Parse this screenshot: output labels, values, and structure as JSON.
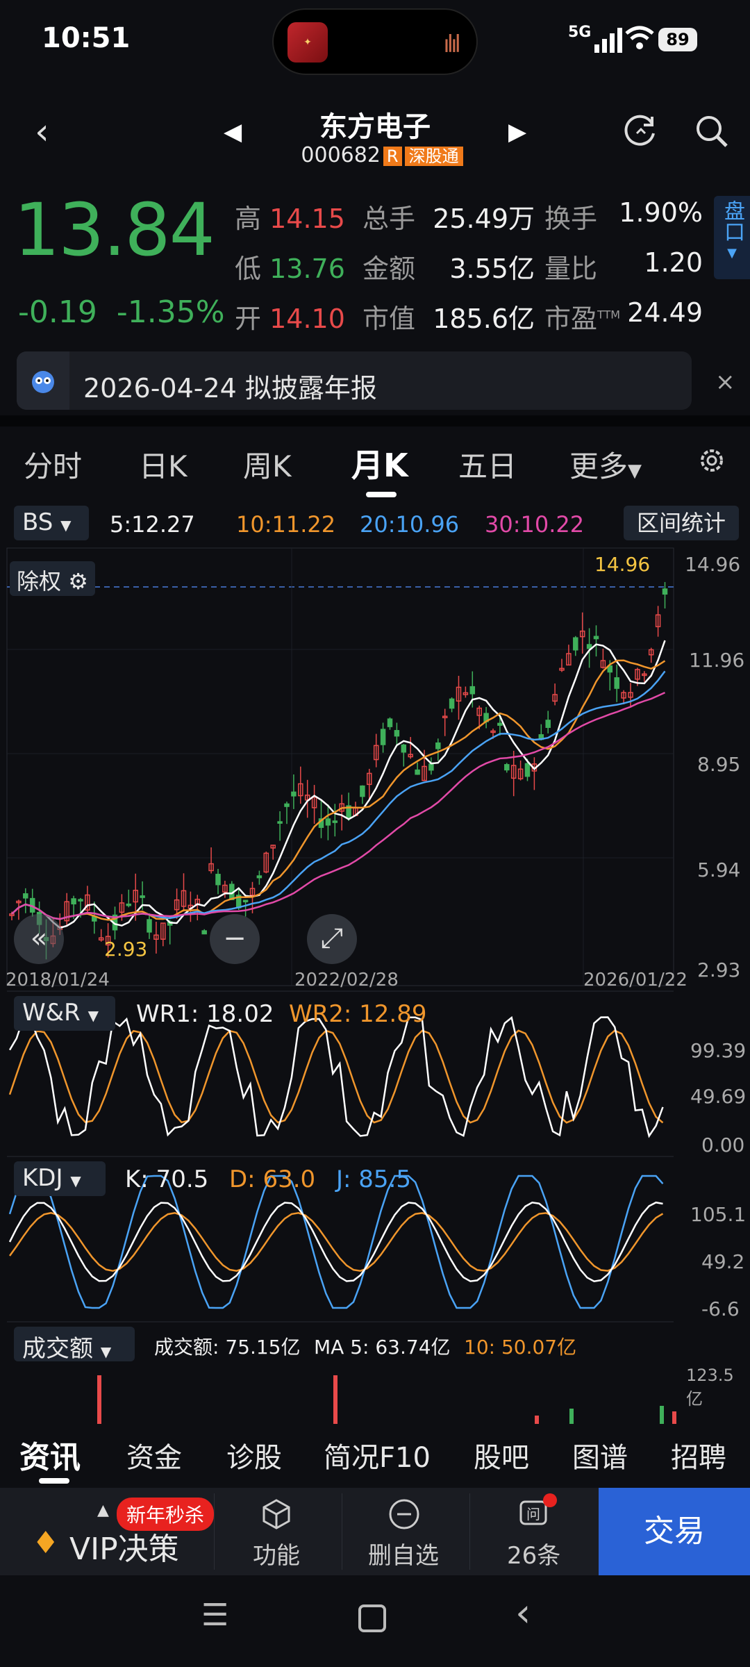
{
  "status": {
    "time": "10:51",
    "network": "5G",
    "battery": "89"
  },
  "header": {
    "name": "东方电子",
    "code": "000682",
    "r_badge": "R",
    "sgt_badge": "深股通"
  },
  "quote": {
    "price": "13.84",
    "change": "-0.19",
    "change_pct": "-1.35%",
    "high_label": "高",
    "high": "14.15",
    "low_label": "低",
    "low": "13.76",
    "open_label": "开",
    "open": "14.10",
    "volume_label": "总手",
    "volume": "25.49万",
    "amount_label": "金额",
    "amount": "3.55亿",
    "mcap_label": "市值",
    "mcap": "185.6亿",
    "turnover_label": "换手",
    "turnover": "1.90%",
    "vratio_label": "量比",
    "vratio": "1.20",
    "pe_label": "市盈",
    "pe_sup": "TTM",
    "pe": "24.49",
    "pankou": "盘口"
  },
  "notice": {
    "text": "2026-04-24 拟披露年报",
    "close": "×"
  },
  "tabs": [
    {
      "label": "分时"
    },
    {
      "label": "日K"
    },
    {
      "label": "周K"
    },
    {
      "label": "月K"
    },
    {
      "label": "五日"
    },
    {
      "label": "更多"
    }
  ],
  "indicator_bar": {
    "bs": "BS",
    "ma5": "5:12.27",
    "ma10": "10:11.22",
    "ma20": "20:10.96",
    "ma30": "30:10.22",
    "range_stats": "区间统计"
  },
  "main_chart": {
    "exright": "除权",
    "y_ticks": [
      "14.96",
      "11.96",
      "8.95",
      "5.94",
      "2.93"
    ],
    "x_ticks": [
      "2018/01/24",
      "2022/02/28",
      "2026/01/22"
    ],
    "max_label": "14.96",
    "min_label": "2.93"
  },
  "wr": {
    "name": "W&R",
    "wr1": "WR1: 18.02",
    "wr2": "WR2: 12.89",
    "ticks": [
      "99.39",
      "49.69",
      "0.00"
    ]
  },
  "kdj": {
    "name": "KDJ",
    "k": "K: 70.5",
    "d": "D: 63.0",
    "j": "J: 85.5",
    "ticks": [
      "105.1",
      "49.2",
      "-6.6"
    ]
  },
  "vol": {
    "name": "成交额",
    "amount": "成交额: 75.15亿",
    "ma5": "MA 5: 63.74亿",
    "ma10": "10: 50.07亿",
    "tick": "123.5亿"
  },
  "bottom_tabs": [
    {
      "label": "资讯"
    },
    {
      "label": "资金"
    },
    {
      "label": "诊股"
    },
    {
      "label": "简况F10"
    },
    {
      "label": "股吧"
    },
    {
      "label": "图谱"
    },
    {
      "label": "招聘"
    }
  ],
  "actions": {
    "vip": "VIP决策",
    "promo": "新年秒杀",
    "func": "功能",
    "remove": "删自选",
    "ask": "26条",
    "trade": "交易"
  },
  "colors": {
    "up": "#e84a4a",
    "down": "#3fb05a",
    "ma5": "#ffffff",
    "ma10": "#f0962c",
    "ma20": "#4aa3f5",
    "ma30": "#e24aa8"
  }
}
